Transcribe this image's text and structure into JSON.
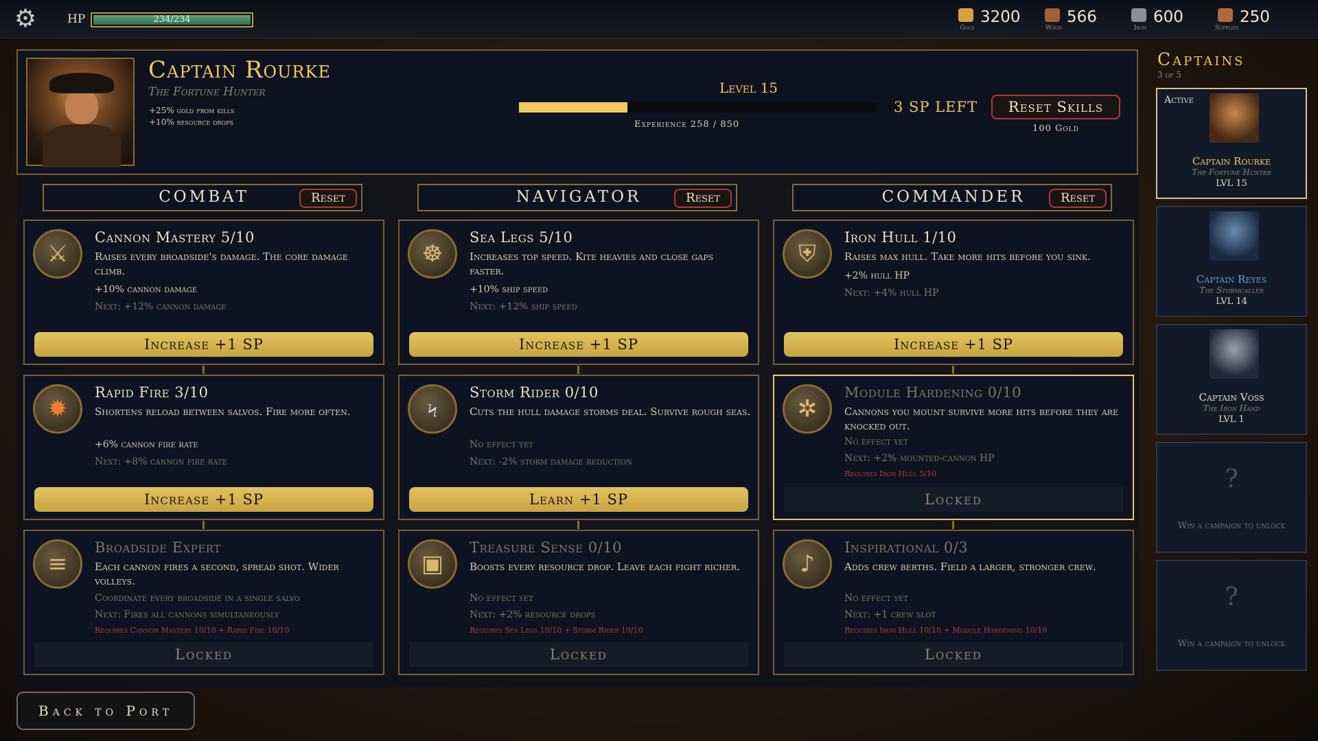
{
  "hud": {
    "hp_label": "HP",
    "hp_text": "234/234",
    "hp_fraction": 1.0,
    "resources": [
      {
        "name": "Gold",
        "value": "3200",
        "icon": "gold-coin-icon",
        "color": "#d8a040"
      },
      {
        "name": "Wood",
        "value": "566",
        "icon": "wood-log-icon",
        "color": "#a0603a"
      },
      {
        "name": "Iron",
        "value": "600",
        "icon": "iron-ingot-icon",
        "color": "#8a8e96"
      },
      {
        "name": "Supplies",
        "value": "250",
        "icon": "supplies-crate-icon",
        "color": "#b06a3a"
      }
    ]
  },
  "captain": {
    "name": "Captain Rourke",
    "title": "The Fortune Hunter",
    "bonuses": [
      "+25% gold from kills",
      "+10% resource drops"
    ],
    "level": "Level 15",
    "xp_text": "Experience 258 / 850",
    "xp_fraction": 0.3035,
    "sp_left": "3 SP LEFT",
    "reset_skills": "Reset Skills",
    "reset_cost": "100 Gold"
  },
  "trees": [
    {
      "name": "COMBAT",
      "reset": "Reset"
    },
    {
      "name": "NAVIGATOR",
      "reset": "Reset"
    },
    {
      "name": "COMMANDER",
      "reset": "Reset"
    }
  ],
  "skills": [
    [
      {
        "title": "Cannon Mastery  5/10",
        "desc": "Raises every broadside's damage. The core damage climb.",
        "e1": "+10% cannon damage",
        "e2": "Next: +12% cannon damage",
        "req": "",
        "btn": "Increase +1 SP",
        "icon": "crossed-cannons-icon"
      },
      {
        "title": "Rapid Fire  3/10",
        "desc": "Shortens reload between salvos. Fire more often.",
        "e1": "+6% cannon fire rate",
        "e2": "Next: +8% cannon fire rate",
        "req": "",
        "btn": "Increase +1 SP",
        "icon": "fireball-icon"
      },
      {
        "title": "Broadside Expert",
        "desc": "Each cannon fires a second, spread shot. Wider volleys.",
        "e1": "Coordinate every broadside in a single salvo",
        "e2": "Next: Fires all cannons simultaneously",
        "req": "Requires Cannon Mastery 10/10 + Rapid Fire 10/10",
        "btn": "Locked",
        "icon": "triple-cannon-icon"
      }
    ],
    [
      {
        "title": "Sea Legs  5/10",
        "desc": "Increases top speed. Kite heavies and close gaps faster.",
        "e1": "+10% ship speed",
        "e2": "Next: +12% ship speed",
        "req": "",
        "btn": "Increase +1 SP",
        "icon": "ship-wheel-icon"
      },
      {
        "title": "Storm Rider  0/10",
        "desc": "Cuts the hull damage storms deal. Survive rough seas.",
        "e1": "No effect yet",
        "e2": "Next: -2% storm damage reduction",
        "req": "",
        "btn": "Learn +1 SP",
        "icon": "lightning-storm-icon"
      },
      {
        "title": "Treasure Sense  0/10",
        "desc": "Boosts every resource drop. Leave each fight richer.",
        "e1": "No effect yet",
        "e2": "Next: +2% resource drops",
        "req": "Requires Sea Legs 10/10 + Storm Rider 10/10",
        "btn": "Locked",
        "icon": "treasure-chest-icon"
      }
    ],
    [
      {
        "title": "Iron Hull  1/10",
        "desc": "Raises max hull. Take more hits before you sink.",
        "e1": "+2% hull HP",
        "e2": "Next: +4% hull HP",
        "req": "",
        "btn": "Increase +1 SP",
        "icon": "shield-icon"
      },
      {
        "title": "Module Hardening  0/10",
        "desc": "Cannons you mount survive more hits before they are knocked out.",
        "e1": "No effect yet",
        "e2": "Next: +2% mounted-cannon HP",
        "req": "Requires Iron Hull 5/10",
        "btn": "Locked",
        "icon": "gear-module-icon"
      },
      {
        "title": "Inspirational  0/3",
        "desc": "Adds crew berths. Field a larger, stronger crew.",
        "e1": "No effect yet",
        "e2": "Next: +1 crew slot",
        "req": "Requires Iron Hull 10/10 + Module Hardening 10/10",
        "btn": "Locked",
        "icon": "horn-icon"
      }
    ]
  ],
  "sidebar": {
    "title": "Captains",
    "count": "3 of 5",
    "active_label": "Active",
    "captains": [
      {
        "name": "Captain Rourke",
        "title": "The Fortune Hunter",
        "level": "LVL 15"
      },
      {
        "name": "Captain Reyes",
        "title": "The Stormcaller",
        "level": "LVL 14"
      },
      {
        "name": "Captain Voss",
        "title": "The Iron Hand",
        "level": "LVL 1"
      }
    ],
    "locked": [
      {
        "q": "?",
        "text": "Win a campaign to unlock"
      },
      {
        "q": "?",
        "text": "Win a campaign to unlock"
      }
    ]
  },
  "back_button": "Back to Port"
}
